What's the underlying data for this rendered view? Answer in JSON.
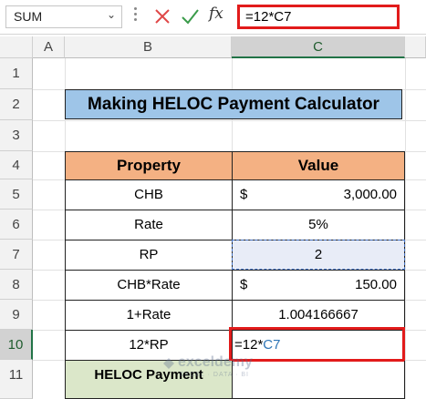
{
  "formula_bar": {
    "name_box": "SUM",
    "formula": "=12*C7",
    "cancel_icon": "close-icon",
    "enter_icon": "check-icon",
    "fx_label": "fx"
  },
  "columns": [
    "A",
    "B",
    "C"
  ],
  "rows": [
    "1",
    "2",
    "3",
    "4",
    "5",
    "6",
    "7",
    "8",
    "9",
    "10",
    "11"
  ],
  "title": "Making HELOC Payment Calculator",
  "table": {
    "headers": [
      "Property",
      "Value"
    ],
    "rows": [
      {
        "label": "CHB",
        "currency": "$",
        "value": "3,000.00"
      },
      {
        "label": "Rate",
        "value": "5%"
      },
      {
        "label": "RP",
        "value": "2"
      },
      {
        "label": "CHB*Rate",
        "currency": "$",
        "value": "150.00"
      },
      {
        "label": "1+Rate",
        "value": "1.004166667"
      },
      {
        "label": "12*RP",
        "formula_prefix": "=12*",
        "formula_ref": "C7"
      },
      {
        "label": "HELOC Payment",
        "value": ""
      }
    ]
  },
  "watermark": {
    "brand": "exceldemy",
    "tagline": "EXCEL · DATA · BI"
  },
  "colors": {
    "title_bg": "#9ec5e8",
    "header_bg": "#f4b183",
    "green_bg": "#dbe7c9",
    "highlight": "#e21b1b",
    "ref_blue": "#2e75b6",
    "selected_border": "#4472c4"
  }
}
